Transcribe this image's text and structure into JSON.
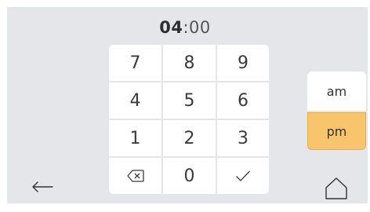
{
  "time": {
    "hours": "04",
    "separator": ":",
    "minutes": "00"
  },
  "keypad": {
    "keys": [
      "7",
      "8",
      "9",
      "4",
      "5",
      "6",
      "1",
      "2",
      "3",
      "0"
    ],
    "backspace_icon": "backspace-icon",
    "confirm_icon": "check-icon"
  },
  "period": {
    "am": "am",
    "pm": "pm",
    "selected": "pm"
  },
  "nav": {
    "back_icon": "arrow-left-icon",
    "home_icon": "home-icon"
  },
  "colors": {
    "background": "#e4e6ea",
    "key": "#ffffff",
    "selected_accent": "#f9c56c"
  }
}
